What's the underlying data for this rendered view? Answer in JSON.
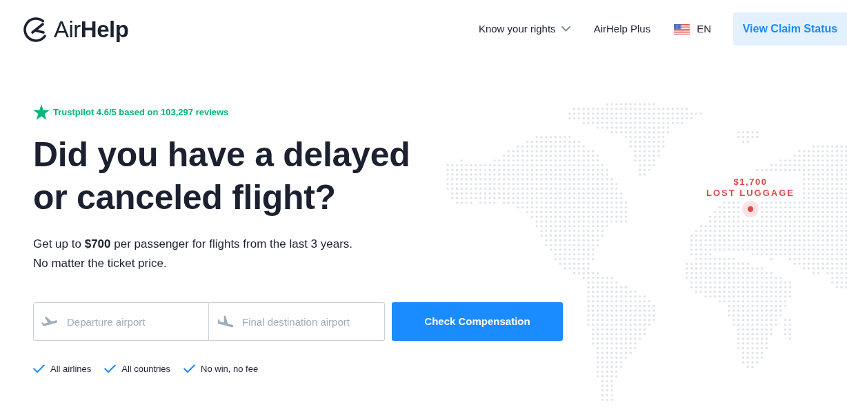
{
  "header": {
    "logo": "Air**Help**",
    "nav": [
      {
        "label": "Know your rights",
        "kind": "dropdown"
      },
      {
        "label": "AirHelp Plus",
        "kind": "link"
      },
      {
        "label": "EN",
        "kind": "language"
      }
    ],
    "cta": "View Claim Status"
  },
  "hero": {
    "rating": "Trustpilot 4.6/5 based on 103,297 reviews",
    "headline": [
      "Did you have a delayed",
      "or canceled flight?"
    ],
    "subtitle": [
      "Get up to **$700** per passenger for flights from the last 3 years.",
      "No matter the ticket price."
    ],
    "form": {
      "fields": [
        {
          "placeholder": "Departure airport",
          "kind": "departure"
        },
        {
          "placeholder": "Final destination airport",
          "kind": "arrival"
        }
      ],
      "button": "Check Compensation"
    },
    "features": [
      "All airlines",
      "All countries",
      "No win, no fee"
    ]
  },
  "map": {
    "marker": {
      "amount": "$1,700",
      "label": "LOST LUGGAGE"
    }
  }
}
